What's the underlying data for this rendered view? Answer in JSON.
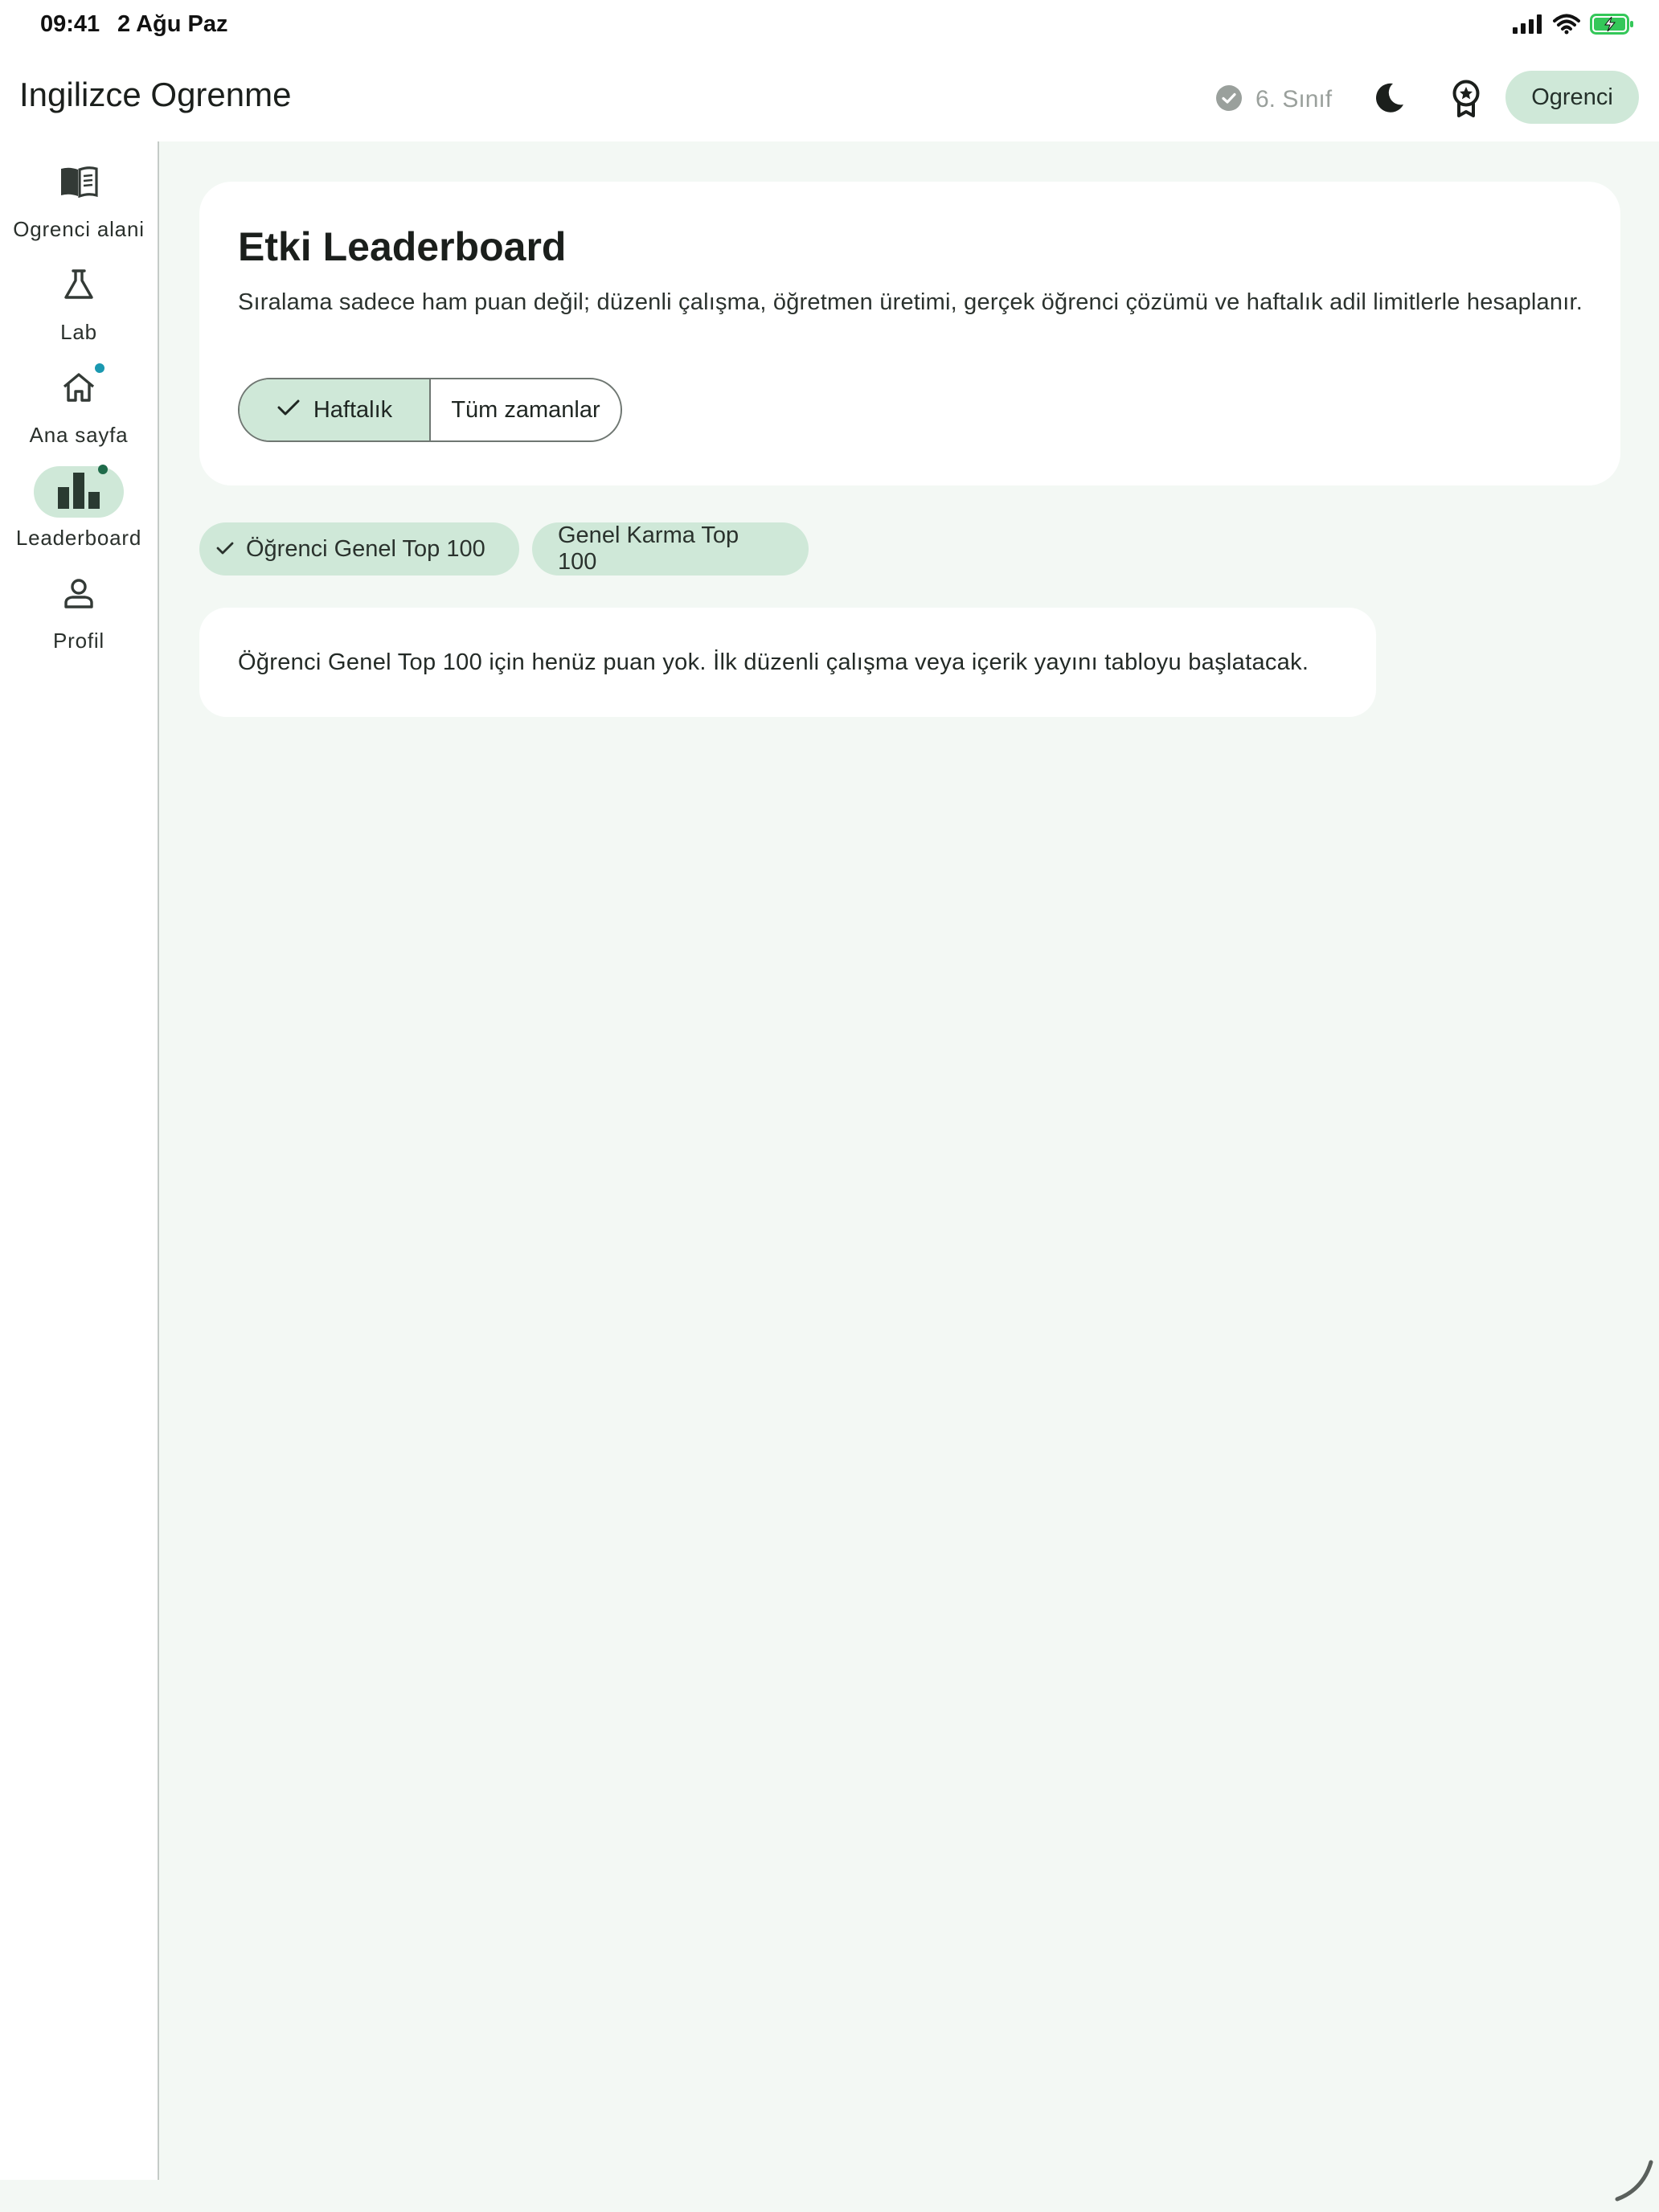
{
  "status_bar": {
    "time": "09:41",
    "date": "2 Ağu Paz"
  },
  "app_bar": {
    "title": "Ingilizce Ogrenme",
    "grade_label": "6. Sınıf",
    "role_label": "Ogrenci",
    "icons": [
      "check-circle-icon",
      "moon-icon",
      "award-icon"
    ]
  },
  "rail": {
    "items": [
      {
        "label": "Ogrenci alani",
        "icon": "book-icon",
        "active": false
      },
      {
        "label": "Lab",
        "icon": "flask-icon",
        "active": false,
        "badge": true
      },
      {
        "label": "Ana sayfa",
        "icon": "home-icon",
        "active": false,
        "badge": true
      },
      {
        "label": "Leaderboard",
        "icon": "bar-chart-icon",
        "active": true,
        "badge": true
      },
      {
        "label": "Profil",
        "icon": "person-icon",
        "active": false
      }
    ]
  },
  "hero": {
    "title": "Etki Leaderboard",
    "description": "Sıralama sadece ham puan değil; düzenli çalışma, öğretmen üretimi, gerçek öğrenci çözümü ve haftalık adil limitlerle hesaplanır.",
    "segments": [
      {
        "label": "Haftalık",
        "selected": true
      },
      {
        "label": "Tüm zamanlar",
        "selected": false
      }
    ]
  },
  "filters": [
    {
      "label": "Öğrenci Genel Top 100",
      "selected": true
    },
    {
      "label": "Genel Karma Top 100",
      "selected": false
    }
  ],
  "empty_state": {
    "message": "Öğrenci Genel Top 100 için henüz puan yok. İlk düzenli çalışma veya içerik yayını tabloyu başlatacak."
  },
  "colors": {
    "accent_container": "#cfe8d8",
    "surface": "#f3f8f4",
    "card": "#ffffff",
    "badge_teal": "#1a98b0",
    "badge_green": "#1f6b4a",
    "battery_green": "#34c759"
  }
}
